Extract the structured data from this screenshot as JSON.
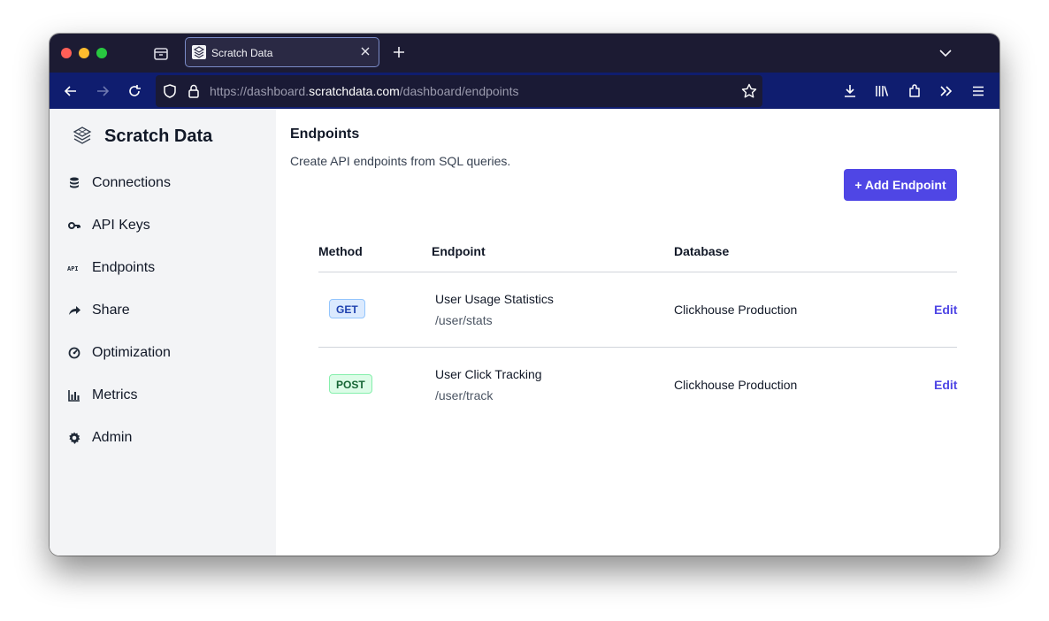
{
  "browser": {
    "tab_title": "Scratch Data",
    "url": {
      "prefix": "https://dashboard.",
      "domain": "scratchdata.com",
      "path": "/dashboard/endpoints"
    }
  },
  "sidebar": {
    "brand": "Scratch Data",
    "items": [
      {
        "label": "Connections",
        "icon": "database-icon"
      },
      {
        "label": "API Keys",
        "icon": "key-icon"
      },
      {
        "label": "Endpoints",
        "icon": "api-icon"
      },
      {
        "label": "Share",
        "icon": "share-arrow-icon"
      },
      {
        "label": "Optimization",
        "icon": "gauge-icon"
      },
      {
        "label": "Metrics",
        "icon": "bar-chart-icon"
      },
      {
        "label": "Admin",
        "icon": "gear-icon"
      }
    ]
  },
  "main": {
    "title": "Endpoints",
    "subtitle": "Create API endpoints from SQL queries.",
    "add_button": "+ Add Endpoint",
    "table": {
      "headers": {
        "method": "Method",
        "endpoint": "Endpoint",
        "database": "Database"
      },
      "rows": [
        {
          "method": "GET",
          "name": "User Usage Statistics",
          "path": "/user/stats",
          "database": "Clickhouse Production",
          "action": "Edit"
        },
        {
          "method": "POST",
          "name": "User Click Tracking",
          "path": "/user/track",
          "database": "Clickhouse Production",
          "action": "Edit"
        }
      ]
    }
  },
  "colors": {
    "accent": "#4f46e5",
    "tab_strip": "#1c1b33",
    "nav_bar": "#0f1d6f",
    "sidebar_bg": "#f3f4f6"
  }
}
